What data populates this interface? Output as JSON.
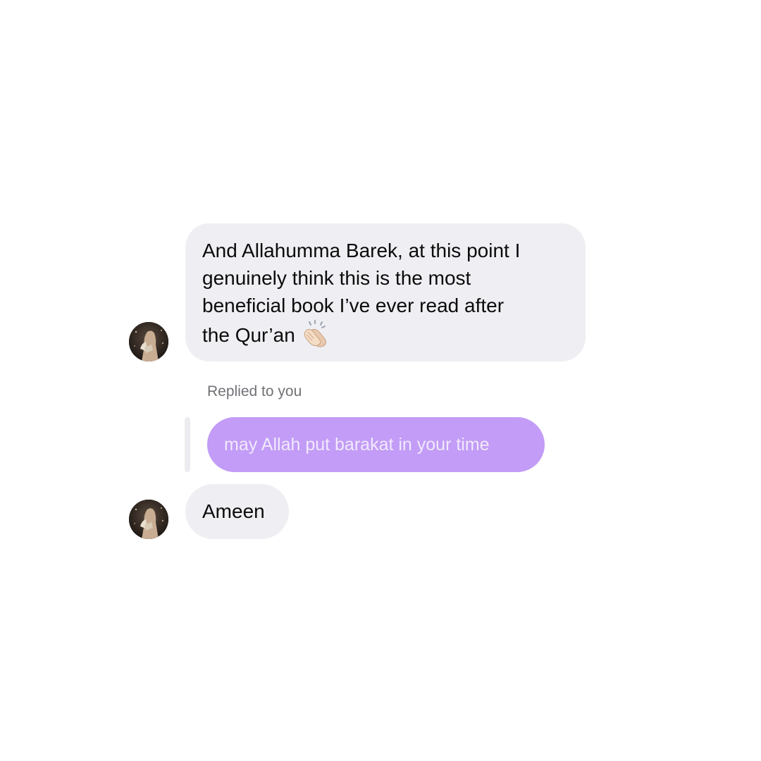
{
  "messages": [
    {
      "sender": "them",
      "text": "And Allahumma Barek, at this point I\ngenuinely think this is the most\nbeneficial book I’ve ever read after\nthe Qur’an",
      "emoji": "clapping-hands-icon"
    },
    {
      "sender": "them",
      "reply_caption": "Replied to you",
      "quoted_text": "may Allah put barakat in your time",
      "text": "Ameen"
    }
  ],
  "colors": {
    "incoming_bubble": "#efeff3",
    "quoted_bubble": "#c29cf6",
    "quoted_text": "#f1e9fd",
    "caption": "#707076"
  }
}
